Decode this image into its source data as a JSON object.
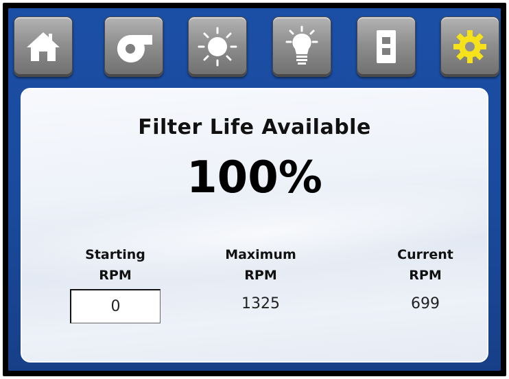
{
  "nav": {
    "buttons": [
      {
        "icon": "home-icon",
        "label": "Home"
      },
      {
        "icon": "blower-icon",
        "label": "Blower"
      },
      {
        "icon": "sun-icon",
        "label": "Sun"
      },
      {
        "icon": "light-bulb-icon",
        "label": "Light"
      },
      {
        "icon": "switch-icon",
        "label": "Switch"
      },
      {
        "icon": "gear-icon",
        "label": "Settings"
      }
    ],
    "colors": {
      "icon": "#ffffff",
      "active_icon": "#f5e21b",
      "background": "#1b4fa6"
    }
  },
  "panel": {
    "title": "Filter Life Available",
    "filter_life": "100%",
    "starting_rpm": {
      "label_line1": "Starting",
      "label_line2": "RPM",
      "value": "0"
    },
    "maximum_rpm": {
      "label_line1": "Maximum",
      "label_line2": "RPM",
      "value": "1325"
    },
    "current_rpm": {
      "label_line1": "Current",
      "label_line2": "RPM",
      "value": "699"
    }
  }
}
